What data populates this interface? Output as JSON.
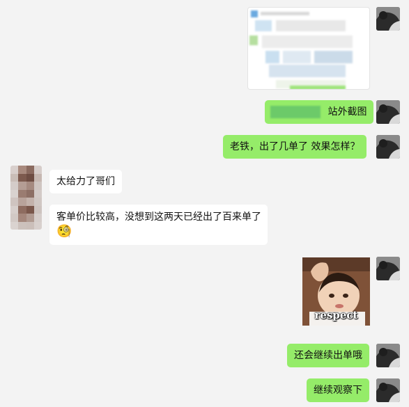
{
  "messages": {
    "m1": {
      "sender": "me",
      "type": "image"
    },
    "m2": {
      "sender": "me",
      "type": "text",
      "text": "站外截图"
    },
    "m3": {
      "sender": "me",
      "type": "text",
      "text": "老铁，出了几单了  效果怎样？"
    },
    "m4": {
      "sender": "other",
      "type": "text",
      "text": "太给力了哥们"
    },
    "m5": {
      "sender": "other",
      "type": "text",
      "text": "客单价比较高，没想到这两天已经出了百来单了",
      "emoji": "🧐"
    },
    "m6": {
      "sender": "me",
      "type": "sticker",
      "caption": "respect"
    },
    "m7": {
      "sender": "me",
      "type": "text",
      "text": "还会继续出单哦"
    },
    "m8": {
      "sender": "me",
      "type": "text",
      "text": "继续观察下"
    }
  },
  "colors": {
    "background": "#f3f3f3",
    "my_bubble": "#95ec69",
    "their_bubble": "#ffffff"
  }
}
